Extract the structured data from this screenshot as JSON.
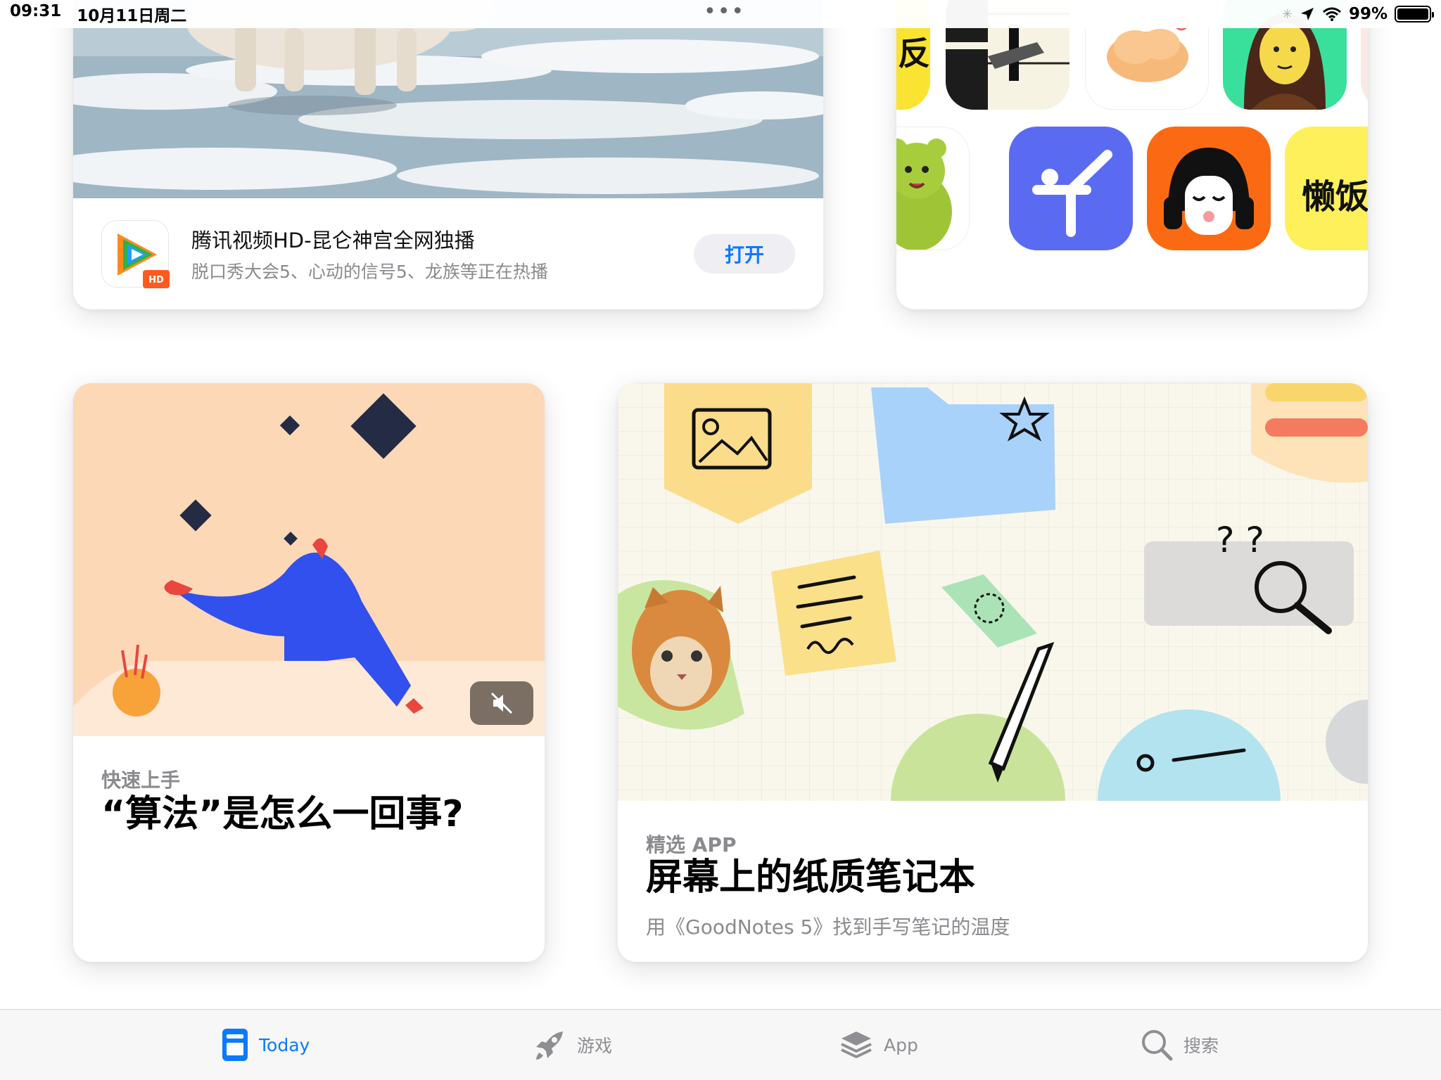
{
  "status_bar": {
    "time": "09:31",
    "date": "10月11日周二",
    "battery": "99%",
    "battery_level": 0.99
  },
  "featured_app": {
    "name": "腾讯视频HD-昆仑神宫全网独播",
    "subtitle": "脱口秀大会5、心动的信号5、龙族等正在热播",
    "action_label": "打开",
    "icon_badge": "HD"
  },
  "app_collection": {
    "icons": [
      "book-icon",
      "piano-icon",
      "cloud-icon",
      "mona-lisa-icon",
      "green-bear-icon",
      "yoga-icon",
      "headphones-face-icon",
      "lazy-text-icon"
    ],
    "partial_texts": [
      "反",
      "懒饭"
    ]
  },
  "algo_card": {
    "label": "快速上手",
    "title": "“算法”是怎么一回事?"
  },
  "goodnotes_card": {
    "label": "精选 APP",
    "title": "屏幕上的纸质笔记本",
    "subtitle": "用《GoodNotes 5》找到手写笔记的温度",
    "illustration_text": "? ?"
  },
  "tabs": [
    {
      "label": "Today",
      "icon": "today-icon",
      "active": true
    },
    {
      "label": "游戏",
      "icon": "rocket-icon",
      "active": false
    },
    {
      "label": "App",
      "icon": "layers-icon",
      "active": false
    },
    {
      "label": "搜索",
      "icon": "search-icon",
      "active": false
    }
  ],
  "colors": {
    "accent": "#0a7aff",
    "tab_inactive": "#8e8e93"
  }
}
